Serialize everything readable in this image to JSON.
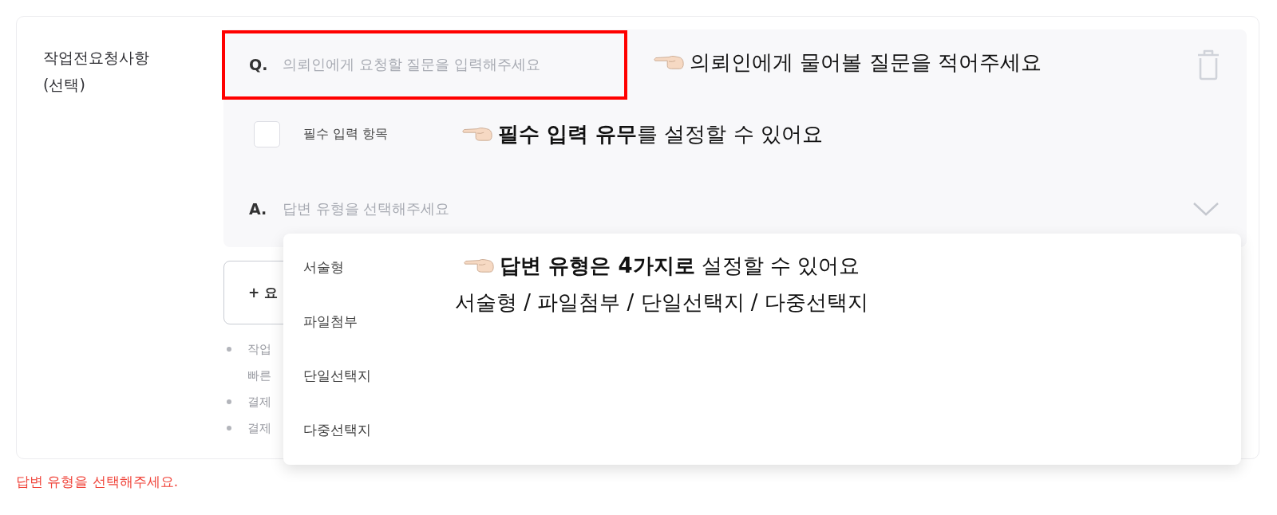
{
  "field_label": {
    "title": "작업전요청사항",
    "note": "(선택)"
  },
  "question": {
    "prefix": "Q.",
    "placeholder": "의뢰인에게 요청할 질문을 입력해주세요"
  },
  "required": {
    "label": "필수 입력 항목",
    "checked": false
  },
  "answer": {
    "prefix": "A.",
    "placeholder": "답변 유형을 선택해주세요",
    "expanded": true
  },
  "add_button": "+ 요",
  "notes": [
    {
      "lines": [
        "작업",
        "빠른"
      ]
    },
    {
      "lines": [
        "결제"
      ]
    },
    {
      "lines": [
        "결제"
      ]
    }
  ],
  "dropdown_options": [
    {
      "label": "서술형",
      "selected": false
    },
    {
      "label": "파일첨부",
      "selected": false
    },
    {
      "label": "단일선택지",
      "selected": false
    },
    {
      "label": "다중선택지",
      "selected": false
    }
  ],
  "error": "답변 유형을 선택해주세요.",
  "annotations": [
    {
      "lines": [
        "의뢰인에게 물어볼 질문을 적어주세요"
      ]
    },
    {
      "lines": [
        "**필수 입력 유무**를 설정할 수 있어요"
      ]
    },
    {
      "lines": [
        "**답변 유형은 4가지로** 설정할 수 있어요",
        "서술형 / 파일첨부 / 단일선택지 / 다중선택지"
      ]
    }
  ]
}
